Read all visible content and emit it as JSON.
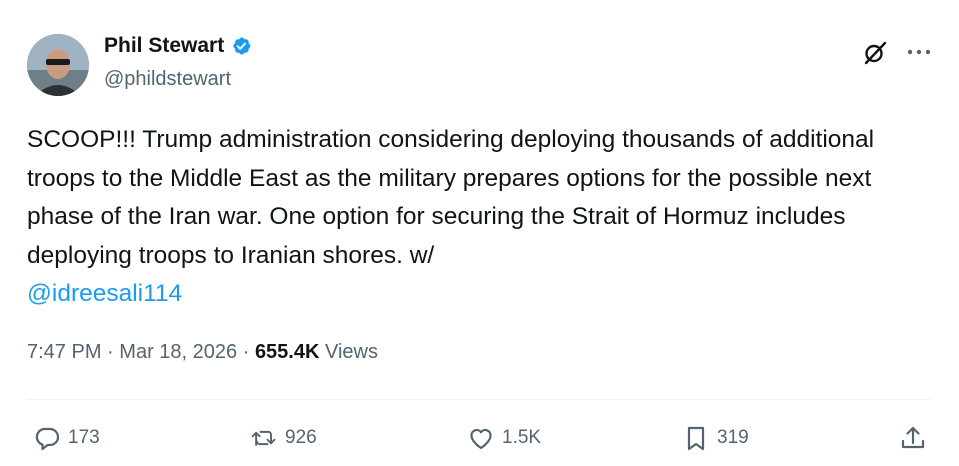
{
  "author": {
    "name": "Phil Stewart",
    "handle": "@phildstewart",
    "verified": true
  },
  "tweet": {
    "text": "SCOOP!!! Trump administration considering deploying thousands of additional troops to the Middle East as the military prepares options for the possible next phase of the Iran war. One option for securing the Strait of Hormuz includes deploying troops to Iranian shores. w/",
    "mention": "@idreesali114"
  },
  "meta": {
    "time": "7:47 PM",
    "separator": "·",
    "date": "Mar 18, 2026",
    "views_count": "655.4K",
    "views_label": "Views"
  },
  "actions": {
    "reply_count": "173",
    "retweet_count": "926",
    "like_count": "1.5K",
    "bookmark_count": "319"
  },
  "colors": {
    "link": "#1d9bf0",
    "verified_badge": "#1d9bf0",
    "secondary_text": "#536471"
  },
  "icons": [
    "verified-badge-icon",
    "grok-icon",
    "more-icon",
    "reply-icon",
    "retweet-icon",
    "like-icon",
    "bookmark-icon",
    "share-icon"
  ]
}
